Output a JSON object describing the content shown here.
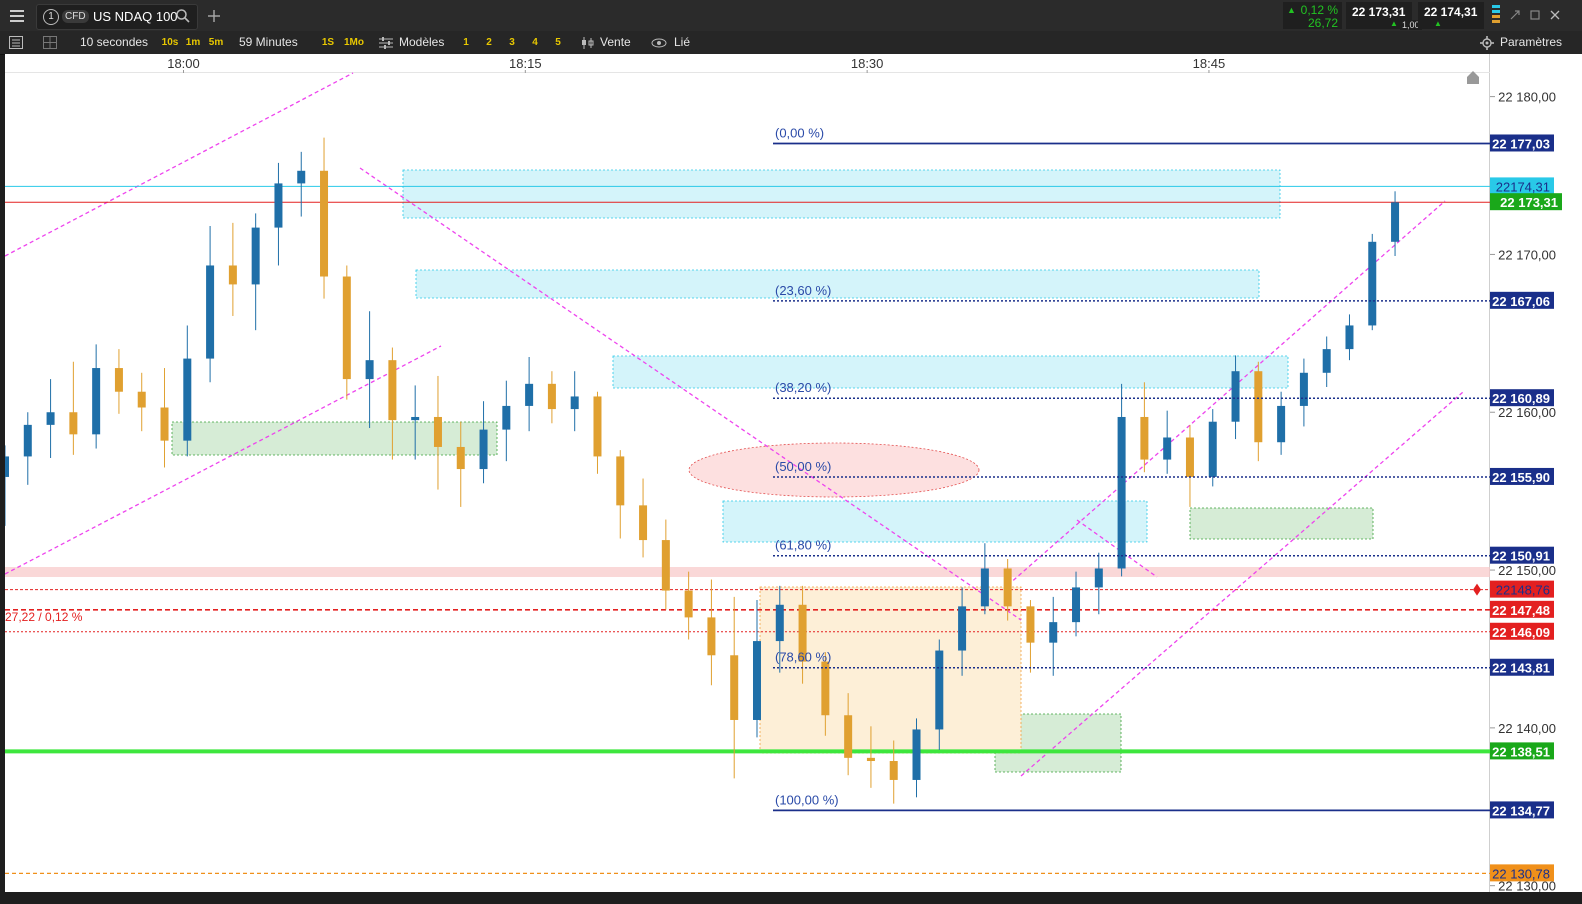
{
  "header": {
    "tab_number": "1",
    "instrument_type": "CFD",
    "instrument_name": "US NDAQ 100",
    "change_percent": "0,12 %",
    "change_points": "26,72",
    "sell_price": "22 173,31",
    "buy_price": "22 174,31",
    "spread": "1,00"
  },
  "toolbar": {
    "interval": "10 secondes",
    "quick_intervals": [
      "10s",
      "1m",
      "5m"
    ],
    "range": "59 Minutes",
    "range_buttons": [
      "1S",
      "1Mo"
    ],
    "models_label": "Modèles",
    "layouts": [
      "1",
      "2",
      "3",
      "4",
      "5"
    ],
    "sell_label": "Vente",
    "linked_label": "Lié",
    "settings_label": "Paramètres"
  },
  "colors": {
    "up": "#1f6fa8",
    "down": "#e0a030",
    "fib": "#1a2f8a",
    "current_price": "#1aa81a",
    "support": "#3de63d",
    "ask": "#29c9e8",
    "alert": "#e32020",
    "orange_level": "#f0901a",
    "magenta": "#ee44ee"
  },
  "chart_data": {
    "type": "candlestick",
    "instrument": "US NDAQ 100",
    "interval": "10 secondes",
    "x_ticks": [
      "18:00",
      "18:15",
      "18:30",
      "18:45"
    ],
    "x_range": [
      "17:52:10",
      "18:57:20"
    ],
    "y_ticks": [
      "22 180,00",
      "22 170,00",
      "22 160,00",
      "22 150,00",
      "22 140,00",
      "22 130,00"
    ],
    "ylim": [
      22129.6,
      22182.7
    ],
    "last_price": 22173.31,
    "ask_price": 22174.31,
    "fibonacci": {
      "levels": [
        {
          "label": "(0,00 %)",
          "price": 22177.03,
          "price_label": "22 177,03"
        },
        {
          "label": "(23,60 %)",
          "price": 22167.06,
          "price_label": "22 167,06"
        },
        {
          "label": "(38,20 %)",
          "price": 22160.89,
          "price_label": "22 160,89"
        },
        {
          "label": "(50,00 %)",
          "price": 22155.9,
          "price_label": "22 155,90"
        },
        {
          "label": "(61,80 %)",
          "price": 22150.91,
          "price_label": "22 150,91"
        },
        {
          "label": "(78,60 %)",
          "price": 22143.81,
          "price_label": "22 143,81"
        },
        {
          "label": "(100,00 %)",
          "price": 22134.77,
          "price_label": "22 134,77"
        }
      ]
    },
    "horizontal_levels": [
      {
        "role": "ask",
        "price": 22174.31,
        "label": "22174,31"
      },
      {
        "role": "last",
        "price": 22173.31,
        "label": "22 173,31"
      },
      {
        "role": "alert",
        "price": 22148.76,
        "label": "22148,76"
      },
      {
        "role": "dashed",
        "price": 22147.48,
        "label": "22 147,48"
      },
      {
        "role": "prev_close",
        "price": 22146.09,
        "label": "22 146,09"
      },
      {
        "role": "support",
        "price": 22138.51,
        "label": "22 138,51"
      },
      {
        "role": "orange_dashed",
        "price": 22130.78,
        "label": "22 130,78"
      }
    ],
    "change_note": "27,22 / 0,12 %",
    "candles": [
      {
        "t": "17:52:10",
        "o": 22155.9,
        "h": 22157.9,
        "l": 22152.8,
        "c": 22157.2
      },
      {
        "t": "17:53:10",
        "o": 22157.2,
        "h": 22160.0,
        "l": 22155.4,
        "c": 22159.2
      },
      {
        "t": "17:54:10",
        "o": 22159.2,
        "h": 22162.1,
        "l": 22157.1,
        "c": 22160.0
      },
      {
        "t": "17:55:10",
        "o": 22160.0,
        "h": 22163.2,
        "l": 22157.3,
        "c": 22158.6
      },
      {
        "t": "17:56:10",
        "o": 22158.6,
        "h": 22164.3,
        "l": 22157.7,
        "c": 22162.8
      },
      {
        "t": "17:57:10",
        "o": 22162.8,
        "h": 22164.0,
        "l": 22159.9,
        "c": 22161.3
      },
      {
        "t": "17:58:10",
        "o": 22161.3,
        "h": 22162.5,
        "l": 22158.8,
        "c": 22160.3
      },
      {
        "t": "17:59:10",
        "o": 22160.3,
        "h": 22162.8,
        "l": 22156.5,
        "c": 22158.2
      },
      {
        "t": "18:00:10",
        "o": 22158.2,
        "h": 22165.5,
        "l": 22157.2,
        "c": 22163.4
      },
      {
        "t": "18:01:10",
        "o": 22163.4,
        "h": 22171.8,
        "l": 22161.9,
        "c": 22169.3
      },
      {
        "t": "18:02:10",
        "o": 22169.3,
        "h": 22172.0,
        "l": 22166.1,
        "c": 22168.1
      },
      {
        "t": "18:03:10",
        "o": 22168.1,
        "h": 22172.6,
        "l": 22165.2,
        "c": 22171.7
      },
      {
        "t": "18:04:10",
        "o": 22171.7,
        "h": 22175.8,
        "l": 22169.3,
        "c": 22174.5
      },
      {
        "t": "18:05:10",
        "o": 22174.5,
        "h": 22176.5,
        "l": 22172.4,
        "c": 22175.3
      },
      {
        "t": "18:06:10",
        "o": 22175.3,
        "h": 22177.4,
        "l": 22167.2,
        "c": 22168.6
      },
      {
        "t": "18:07:10",
        "o": 22168.6,
        "h": 22169.3,
        "l": 22160.8,
        "c": 22162.1
      },
      {
        "t": "18:08:10",
        "o": 22162.1,
        "h": 22166.4,
        "l": 22159.0,
        "c": 22163.3
      },
      {
        "t": "18:09:10",
        "o": 22163.3,
        "h": 22164.1,
        "l": 22157.0,
        "c": 22159.5
      },
      {
        "t": "18:10:10",
        "o": 22159.5,
        "h": 22161.7,
        "l": 22157.0,
        "c": 22159.7
      },
      {
        "t": "18:11:10",
        "o": 22159.7,
        "h": 22162.3,
        "l": 22155.1,
        "c": 22157.8
      },
      {
        "t": "18:12:10",
        "o": 22157.8,
        "h": 22159.4,
        "l": 22154.0,
        "c": 22156.4
      },
      {
        "t": "18:13:10",
        "o": 22156.4,
        "h": 22160.7,
        "l": 22155.5,
        "c": 22158.9
      },
      {
        "t": "18:14:10",
        "o": 22158.9,
        "h": 22162.0,
        "l": 22156.9,
        "c": 22160.4
      },
      {
        "t": "18:15:10",
        "o": 22160.4,
        "h": 22163.5,
        "l": 22158.8,
        "c": 22161.8
      },
      {
        "t": "18:16:10",
        "o": 22161.8,
        "h": 22162.6,
        "l": 22159.3,
        "c": 22160.2
      },
      {
        "t": "18:17:10",
        "o": 22160.2,
        "h": 22162.6,
        "l": 22158.8,
        "c": 22161.0
      },
      {
        "t": "18:18:10",
        "o": 22161.0,
        "h": 22161.3,
        "l": 22156.1,
        "c": 22157.2
      },
      {
        "t": "18:19:10",
        "o": 22157.2,
        "h": 22157.6,
        "l": 22152.0,
        "c": 22154.1
      },
      {
        "t": "18:20:10",
        "o": 22154.1,
        "h": 22155.8,
        "l": 22150.8,
        "c": 22151.9
      },
      {
        "t": "18:21:10",
        "o": 22151.9,
        "h": 22153.2,
        "l": 22147.5,
        "c": 22148.7
      },
      {
        "t": "18:22:10",
        "o": 22148.7,
        "h": 22149.9,
        "l": 22145.6,
        "c": 22147.0
      },
      {
        "t": "18:23:10",
        "o": 22147.0,
        "h": 22149.4,
        "l": 22142.7,
        "c": 22144.6
      },
      {
        "t": "18:24:10",
        "o": 22144.6,
        "h": 22148.3,
        "l": 22136.8,
        "c": 22140.5
      },
      {
        "t": "18:25:10",
        "o": 22140.5,
        "h": 22148.1,
        "l": 22139.4,
        "c": 22145.5
      },
      {
        "t": "18:26:10",
        "o": 22145.5,
        "h": 22149.0,
        "l": 22143.5,
        "c": 22147.8
      },
      {
        "t": "18:27:10",
        "o": 22147.8,
        "h": 22149.0,
        "l": 22142.8,
        "c": 22144.2
      },
      {
        "t": "18:28:10",
        "o": 22144.2,
        "h": 22144.8,
        "l": 22139.5,
        "c": 22140.8
      },
      {
        "t": "18:29:10",
        "o": 22140.8,
        "h": 22142.2,
        "l": 22137.0,
        "c": 22138.1
      },
      {
        "t": "18:30:10",
        "o": 22138.1,
        "h": 22140.1,
        "l": 22136.2,
        "c": 22137.9
      },
      {
        "t": "18:31:10",
        "o": 22137.9,
        "h": 22139.2,
        "l": 22135.2,
        "c": 22136.7
      },
      {
        "t": "18:32:10",
        "o": 22136.7,
        "h": 22140.6,
        "l": 22135.6,
        "c": 22139.9
      },
      {
        "t": "18:33:10",
        "o": 22139.9,
        "h": 22145.6,
        "l": 22138.6,
        "c": 22144.9
      },
      {
        "t": "18:34:10",
        "o": 22144.9,
        "h": 22148.9,
        "l": 22143.3,
        "c": 22147.7
      },
      {
        "t": "18:35:10",
        "o": 22147.7,
        "h": 22151.7,
        "l": 22147.2,
        "c": 22150.1
      },
      {
        "t": "18:36:10",
        "o": 22150.1,
        "h": 22150.7,
        "l": 22146.8,
        "c": 22147.7
      },
      {
        "t": "18:37:10",
        "o": 22147.7,
        "h": 22148.1,
        "l": 22143.5,
        "c": 22145.4
      },
      {
        "t": "18:38:10",
        "o": 22145.4,
        "h": 22148.3,
        "l": 22143.3,
        "c": 22146.7
      },
      {
        "t": "18:39:10",
        "o": 22146.7,
        "h": 22149.9,
        "l": 22145.8,
        "c": 22148.9
      },
      {
        "t": "18:40:10",
        "o": 22148.9,
        "h": 22151.1,
        "l": 22147.2,
        "c": 22150.1
      },
      {
        "t": "18:41:10",
        "o": 22150.1,
        "h": 22161.8,
        "l": 22149.6,
        "c": 22159.7
      },
      {
        "t": "18:42:10",
        "o": 22159.7,
        "h": 22161.9,
        "l": 22156.2,
        "c": 22157.0
      },
      {
        "t": "18:43:10",
        "o": 22157.0,
        "h": 22160.1,
        "l": 22156.1,
        "c": 22158.4
      },
      {
        "t": "18:44:10",
        "o": 22158.4,
        "h": 22159.2,
        "l": 22154.0,
        "c": 22155.9
      },
      {
        "t": "18:45:10",
        "o": 22155.9,
        "h": 22160.2,
        "l": 22155.3,
        "c": 22159.4
      },
      {
        "t": "18:46:10",
        "o": 22159.4,
        "h": 22163.6,
        "l": 22158.3,
        "c": 22162.6
      },
      {
        "t": "18:47:10",
        "o": 22162.6,
        "h": 22163.2,
        "l": 22156.9,
        "c": 22158.1
      },
      {
        "t": "18:48:10",
        "o": 22158.1,
        "h": 22161.3,
        "l": 22157.3,
        "c": 22160.4
      },
      {
        "t": "18:49:10",
        "o": 22160.4,
        "h": 22163.4,
        "l": 22159.1,
        "c": 22162.5
      },
      {
        "t": "18:50:10",
        "o": 22162.5,
        "h": 22164.8,
        "l": 22161.6,
        "c": 22164.0
      },
      {
        "t": "18:51:10",
        "o": 22164.0,
        "h": 22166.2,
        "l": 22163.3,
        "c": 22165.5
      },
      {
        "t": "18:52:10",
        "o": 22165.5,
        "h": 22171.3,
        "l": 22165.2,
        "c": 22170.8
      },
      {
        "t": "18:53:10",
        "o": 22170.8,
        "h": 22174.0,
        "l": 22169.9,
        "c": 22173.3
      }
    ]
  }
}
